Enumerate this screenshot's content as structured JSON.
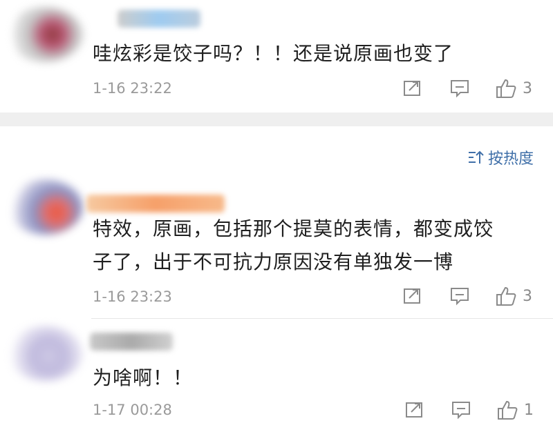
{
  "comments": [
    {
      "text": "哇炫彩是饺子吗？！！还是说原画也变了",
      "time": "1-16 23:22",
      "likes": "3"
    },
    {
      "text_line1": "特效，原画，包括那个提莫的表情，都变成饺",
      "text_line2": "子了，出于不可抗力原因没有单独发一博",
      "time": "1-16 23:23",
      "likes": "3"
    },
    {
      "text": "为啥啊！！",
      "time": "1-17 00:28",
      "likes": "1"
    }
  ],
  "sort": {
    "label": "按热度",
    "icon": "sort-icon"
  },
  "colors": {
    "link": "#3f6fa8",
    "meta": "#9a9a9a",
    "band": "#efefef"
  }
}
